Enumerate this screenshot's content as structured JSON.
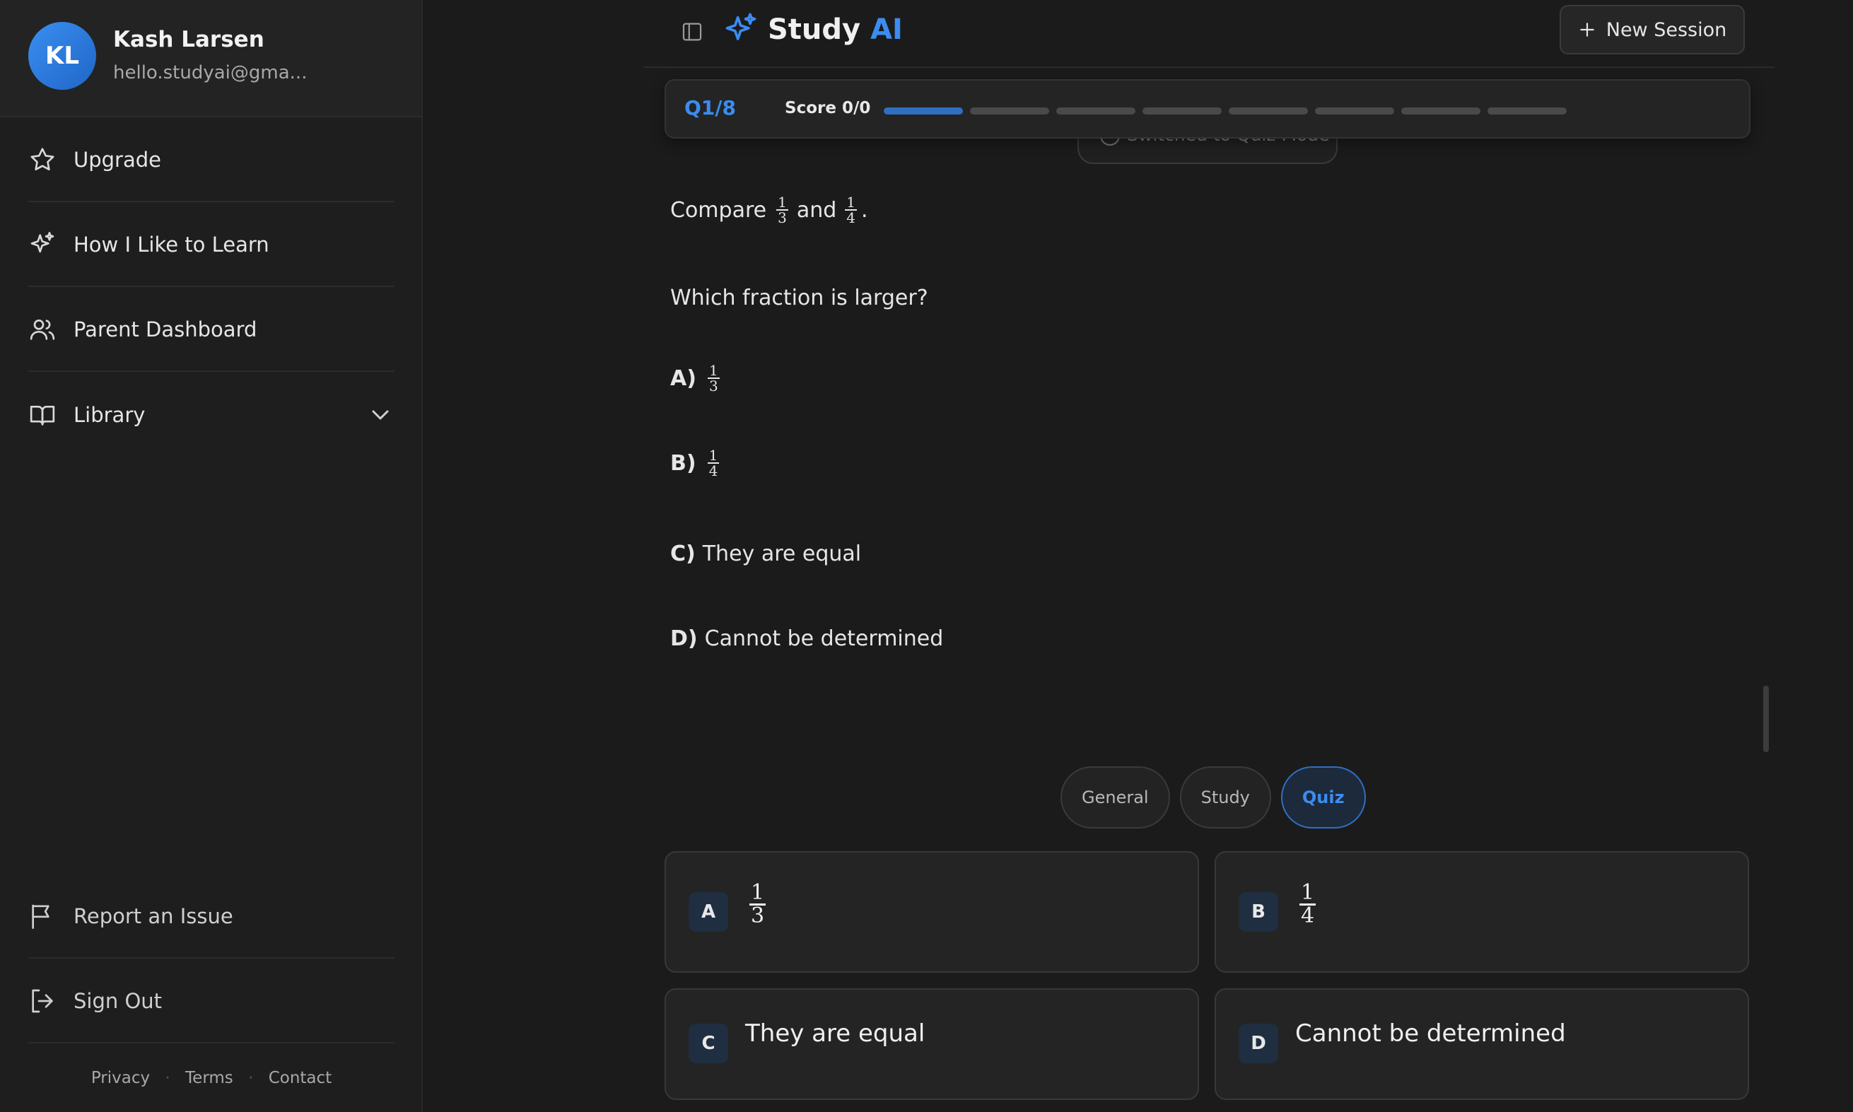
{
  "user": {
    "initials": "KL",
    "name": "Kash Larsen",
    "email": "hello.studyai@gma..."
  },
  "sidebar": {
    "items": [
      {
        "label": "Upgrade"
      },
      {
        "label": "How I Like to Learn"
      },
      {
        "label": "Parent Dashboard"
      },
      {
        "label": "Library"
      }
    ],
    "bottom": [
      {
        "label": "Report an Issue"
      },
      {
        "label": "Sign Out"
      }
    ],
    "footer": {
      "privacy": "Privacy",
      "terms": "Terms",
      "contact": "Contact",
      "separator": "·"
    }
  },
  "header": {
    "brand_main": "Study",
    "brand_accent": "AI",
    "new_session": "New Session"
  },
  "quiz": {
    "question_number": "Q1/8",
    "score": "Score 0/0",
    "progress": {
      "total": 8,
      "current": 1
    },
    "toast": "Switched to Quiz Mode"
  },
  "message": {
    "compare_word": "Compare",
    "and_word": "and",
    "period": ".",
    "frac1": {
      "num": "1",
      "den": "3"
    },
    "frac2": {
      "num": "1",
      "den": "4"
    },
    "question": "Which fraction is larger?",
    "options": [
      {
        "letter": "A)",
        "num": "1",
        "den": "3"
      },
      {
        "letter": "B)",
        "num": "1",
        "den": "4"
      },
      {
        "letter": "C)",
        "text": "They are equal"
      },
      {
        "letter": "D)",
        "text": "Cannot be determined"
      }
    ]
  },
  "modes": {
    "general": "General",
    "study": "Study",
    "quiz": "Quiz",
    "active": "Quiz"
  },
  "answers": [
    {
      "letter": "A",
      "num": "1",
      "den": "3"
    },
    {
      "letter": "B",
      "num": "1",
      "den": "4"
    },
    {
      "letter": "C",
      "text": "They are equal"
    },
    {
      "letter": "D",
      "text": "Cannot be determined"
    }
  ],
  "colors": {
    "accent": "#3b8cf0",
    "background": "#1b1b1b",
    "sidebar": "#1e1e1e"
  }
}
